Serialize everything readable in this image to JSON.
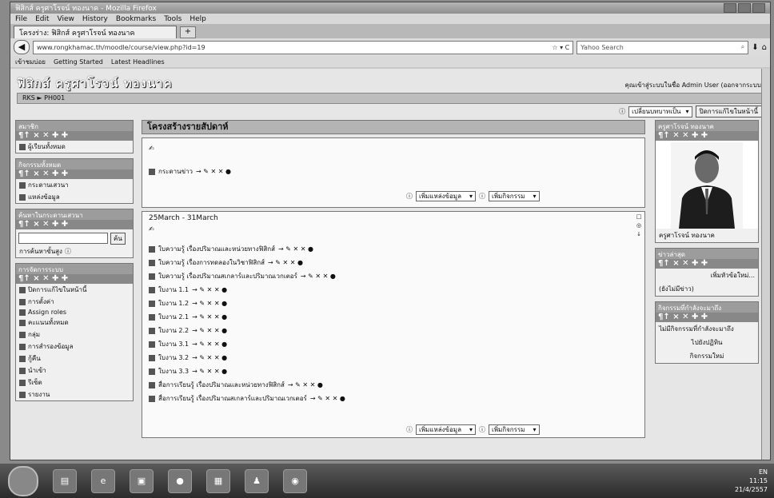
{
  "browser": {
    "title": "ฟิสิกส์ ครูศาโรจน์ ทองนาค - Mozilla Firefox",
    "menu": [
      "File",
      "Edit",
      "View",
      "History",
      "Bookmarks",
      "Tools",
      "Help"
    ],
    "tab_label": "โครงร่าง: ฟิสิกส์ ครูศาโรจน์ ทองนาค",
    "new_tab": "+",
    "url": "www.rongkhamac.th/moodle/course/view.php?id=19",
    "search_placeholder": "Yahoo Search",
    "bookmarks": [
      "เข้าชมบ่อย",
      "Getting Started",
      "Latest Headlines"
    ]
  },
  "site": {
    "title": "ฟิสิกส์ ครูศาโรจน์ ทองนาค",
    "login_text": "คุณเข้าสู่ระบบในชื่อ Admin User (ออกจากระบบ)",
    "breadcrumb": "RKS ► PH001",
    "role_select": "เปลี่ยนบทบาทเป็น",
    "edit_button": "ปิดการแก้ไขในหน้านี้"
  },
  "left_blocks": [
    {
      "head": "สมาชิก",
      "icons": "¶↑ × ✕ ✚ ✚",
      "items": [
        "ผู้เรียนทั้งหมด"
      ]
    },
    {
      "head": "กิจกรรมทั้งหมด",
      "icons": "¶↑ × ✕ ✚ ✚",
      "items": [
        "กระดานเสวนา",
        "แหล่งข้อมูล"
      ]
    },
    {
      "head": "ค้นหาในกระดานเสวนา",
      "icons": "¶↑ × ✕ ✚ ✚",
      "search_button": "ค้น",
      "advanced": "การค้นหาขั้นสูง"
    },
    {
      "head": "การจัดการระบบ",
      "icons": "¶↑ × ✕ ✚ ✚",
      "items": [
        "ปิดการแก้ไขในหน้านี้",
        "การตั้งค่า",
        "Assign roles",
        "คะแนนทั้งหมด",
        "กลุ่ม",
        "การสำรองข้อมูล",
        "กู้คืน",
        "นำเข้า",
        "รีเซ็ต",
        "รายงาน"
      ]
    }
  ],
  "center": {
    "section_title": "โครงสร้างรายสัปดาห์",
    "intro_label": "✍",
    "intro_item": "กระดานข่าว",
    "add_resource": "เพิ่มแหล่งข้อมูล",
    "add_activity": "เพิ่มกิจกรรม",
    "week_title": "25March - 31March",
    "items": [
      "ใบความรู้ เรื่องปริมาณและหน่วยทางฟิสิกส์",
      "ใบความรู้ เรื่องการทดลองในวิชาฟิสิกส์",
      "ใบความรู้ เรื่องปริมาณสเกลาร์และปริมาณเวกเตอร์",
      "ใบงาน 1.1",
      "ใบงาน 1.2",
      "ใบงาน 2.1",
      "ใบงาน 2.2",
      "ใบงาน 3.1",
      "ใบงาน 3.2",
      "ใบงาน 3.3",
      "สื่อการเรียนรู้ เรื่องปริมาณและหน่วยทางฟิสิกส์",
      "สื่อการเรียนรู้ เรื่องปริมาณสเกลาร์และปริมาณเวกเตอร์"
    ],
    "item_actions": "→ ✎ ✕ ✕ ●"
  },
  "right_blocks": {
    "teacher_head": "ครูศาโรจน์ ทองนาค",
    "teacher_caption": "ครูศาโรจน์ ทองนาค",
    "news_head": "ข่าวล่าสุด",
    "news_add": "เพิ่มหัวข้อใหม่...",
    "news_empty": "(ยังไม่มีข่าว)",
    "events_head": "กิจกรรมที่กำลังจะมาถึง",
    "events_text": "ไม่มีกิจกรรมที่กำลังจะมาถึง",
    "events_link": "ไปยังปฏิทิน",
    "events_new": "กิจกรรมใหม่"
  },
  "taskbar": {
    "tray_lang": "EN",
    "time": "11:15",
    "date": "21/4/2557"
  }
}
